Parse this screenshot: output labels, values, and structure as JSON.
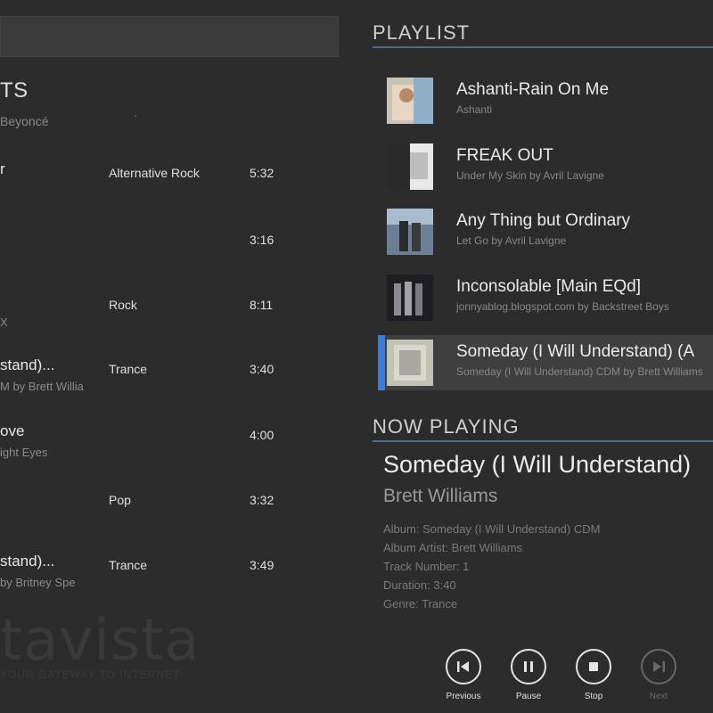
{
  "left": {
    "header_title": "TS",
    "header_sub": "Beyoncé",
    "header_dot": "·",
    "rows": [
      {
        "t1": "r",
        "t2": "",
        "genre": "Alternative Rock",
        "dur": "5:32"
      },
      {
        "t1": "",
        "t2": "",
        "genre": "",
        "dur": "3:16"
      },
      {
        "t1": "",
        "t2": "X",
        "genre": "Rock",
        "dur": "8:11"
      },
      {
        "t1": "stand)...",
        "t2": "M by Brett Willia",
        "genre": "Trance",
        "dur": "3:40"
      },
      {
        "t1": "ove",
        "t2": "ight Eyes",
        "genre": "",
        "dur": "4:00"
      },
      {
        "t1": "",
        "t2": "",
        "genre": "Pop",
        "dur": "3:32"
      },
      {
        "t1": "stand)...",
        "t2": "by Britney Spe",
        "genre": "Trance",
        "dur": "3:49"
      }
    ],
    "watermark": "tavista",
    "watermark_sub": "YOUR GATEWAY TO INTERNET"
  },
  "playlist": {
    "header": "PLAYLIST",
    "items": [
      {
        "title": "Ashanti-Rain On Me",
        "subtitle": "Ashanti"
      },
      {
        "title": "FREAK OUT",
        "subtitle": "Under My Skin by Avril Lavigne"
      },
      {
        "title": "Any Thing but Ordinary",
        "subtitle": "Let Go by Avril Lavigne"
      },
      {
        "title": "Inconsolable [Main EQd]",
        "subtitle": "jonnyablog.blogspot.com by Backstreet Boys"
      },
      {
        "title": "Someday (I Will Understand) (A",
        "subtitle": "Someday (I Will Understand) CDM by Brett Williams"
      }
    ],
    "selected_index": 4
  },
  "now_playing": {
    "header": "NOW PLAYING",
    "title": "Someday (I Will Understand)",
    "artist": "Brett Williams",
    "details": [
      "Album: Someday (I Will Understand) CDM",
      "Album Artist: Brett Williams",
      "Track Number: 1",
      "Duration: 3:40",
      "Genre: Trance"
    ]
  },
  "controls": [
    {
      "label": "Previous",
      "icon": "previous-icon",
      "enabled": true
    },
    {
      "label": "Pause",
      "icon": "pause-icon",
      "enabled": true
    },
    {
      "label": "Stop",
      "icon": "stop-icon",
      "enabled": true
    },
    {
      "label": "Next",
      "icon": "next-icon",
      "enabled": false
    }
  ],
  "colors": {
    "background": "#2c2c2c",
    "accent": "#3d7bd6",
    "section_line": "#4c6a8f"
  }
}
